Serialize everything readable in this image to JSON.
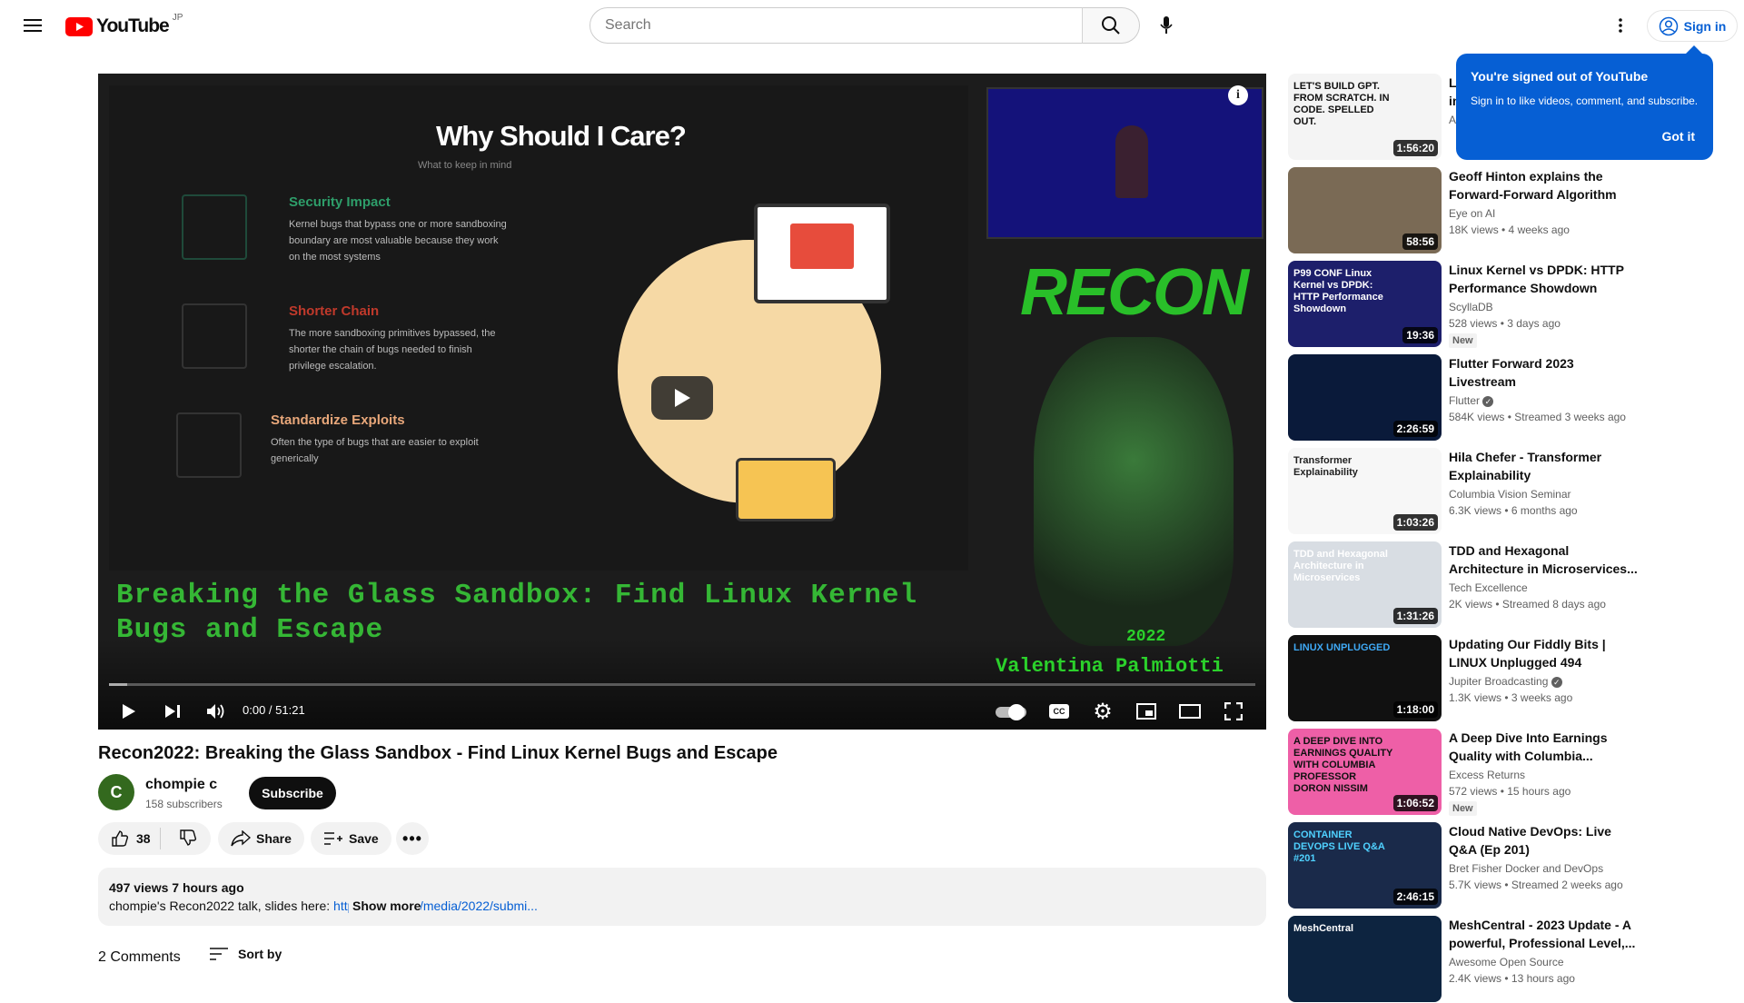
{
  "header": {
    "logo": "YouTube",
    "region": "JP",
    "search_placeholder": "Search",
    "signin": "Sign in"
  },
  "player": {
    "slide_title": "Why Should I Care?",
    "slide_subtitle": "What to keep in mind",
    "features": [
      {
        "title": "Security Impact",
        "color": "#2e9e6a",
        "text": "Kernel bugs that bypass one or more sandboxing boundary are most valuable because they work on the most systems"
      },
      {
        "title": "Shorter Chain",
        "color": "#c0392b",
        "text": "The more sandboxing primitives bypassed, the shorter the chain of bugs needed to finish privilege escalation."
      },
      {
        "title": "Standardize Exploits",
        "color": "#e8a77a",
        "text": "Often the type of bugs that are easier to exploit generically"
      }
    ],
    "overlay_title": "Breaking the Glass Sandbox: Find Linux Kernel Bugs and Escape",
    "logo_text": "RECON",
    "year": "2022",
    "speaker": "Valentina Palmiotti",
    "time": "0:00 / 51:21",
    "progress_percent": 0
  },
  "video": {
    "title": "Recon2022: Breaking the Glass Sandbox - Find Linux Kernel Bugs and Escape",
    "channel": "chompie c",
    "avatar_letter": "C",
    "subscribers": "158 subscribers",
    "subscribe": "Subscribe",
    "likes": "38",
    "share": "Share",
    "save": "Save"
  },
  "description": {
    "stats": "497 views  7 hours ago",
    "text": "chompie's Recon2022 talk, slides here: ",
    "link": "https://recon.cx/media/2022/submi...",
    "show_more": "Show more"
  },
  "comments": {
    "count": "2 Comments",
    "sort": "Sort by"
  },
  "popup": {
    "title": "You're signed out of YouTube",
    "text": "Sign in to like videos, comment, and subscribe.",
    "button": "Got it"
  },
  "recommendations": [
    {
      "title": "Let's build GPT: from scratch, in code, spelled out.",
      "channel": "Andrej Karpathy",
      "meta": "",
      "duration": "1:56:20",
      "thumb_text": "LET'S BUILD GPT. FROM SCRATCH. IN CODE. SPELLED OUT.",
      "bg": "#f4f4f4",
      "fg": "#111"
    },
    {
      "title": "Geoff Hinton explains the Forward-Forward Algorithm",
      "channel": "Eye on AI",
      "meta": "18K views  •  4 weeks ago",
      "duration": "58:56",
      "thumb_text": "",
      "bg": "#7a6a55",
      "fg": "#fff"
    },
    {
      "title": "Linux Kernel vs DPDK: HTTP Performance Showdown",
      "channel": "ScyllaDB",
      "meta": "528 views  •  3 days ago",
      "new": "New",
      "duration": "19:36",
      "thumb_text": "P99 CONF  Linux Kernel vs DPDK: HTTP Performance Showdown",
      "bg": "#1d1f6b",
      "fg": "#fff"
    },
    {
      "title": "Flutter Forward 2023 Livestream",
      "channel": "Flutter",
      "verified": true,
      "meta": "584K views  •  Streamed 3 weeks ago",
      "duration": "2:26:59",
      "thumb_text": "",
      "bg": "#0a1a3a",
      "fg": "#fff"
    },
    {
      "title": "Hila Chefer - Transformer Explainability",
      "channel": "Columbia Vision Seminar",
      "meta": "6.3K views  •  6 months ago",
      "duration": "1:03:26",
      "thumb_text": "Transformer Explainability",
      "bg": "#f7f7f7",
      "fg": "#222"
    },
    {
      "title": "TDD and Hexagonal Architecture in Microservices...",
      "channel": "Tech Excellence",
      "meta": "2K views  •  Streamed 8 days ago",
      "duration": "1:31:26",
      "thumb_text": "TDD and Hexagonal Architecture in Microservices",
      "bg": "#d8dde3",
      "fg": "#fff"
    },
    {
      "title": "Updating Our Fiddly Bits | LINUX Unplugged 494",
      "channel": "Jupiter Broadcasting",
      "verified": true,
      "meta": "1.3K views  •  3 weeks ago",
      "duration": "1:18:00",
      "thumb_text": "LINUX UNPLUGGED",
      "bg": "#111",
      "fg": "#3fa9f5"
    },
    {
      "title": "A Deep Dive Into Earnings Quality with Columbia...",
      "channel": "Excess Returns",
      "meta": "572 views  •  15 hours ago",
      "new": "New",
      "duration": "1:06:52",
      "thumb_text": "A DEEP DIVE INTO EARNINGS QUALITY WITH COLUMBIA PROFESSOR DORON NISSIM",
      "bg": "#ee5fa7",
      "fg": "#111"
    },
    {
      "title": "Cloud Native DevOps: Live Q&A (Ep 201)",
      "channel": "Bret Fisher Docker and DevOps",
      "meta": "5.7K views  •  Streamed 2 weeks ago",
      "duration": "2:46:15",
      "thumb_text": "CONTAINER DEVOPS LIVE Q&A #201",
      "bg": "#1a2a4a",
      "fg": "#4fd1ff"
    },
    {
      "title": "MeshCentral - 2023 Update - A powerful, Professional Level,...",
      "channel": "Awesome Open Source",
      "meta": "2.4K views  •  13 hours ago",
      "duration": "",
      "thumb_text": "MeshCentral",
      "bg": "#0d2440",
      "fg": "#fff"
    }
  ],
  "colors": {
    "accent": "#065fd4",
    "youtube_red": "#ff0000",
    "overlay_green": "#3ad33a"
  }
}
